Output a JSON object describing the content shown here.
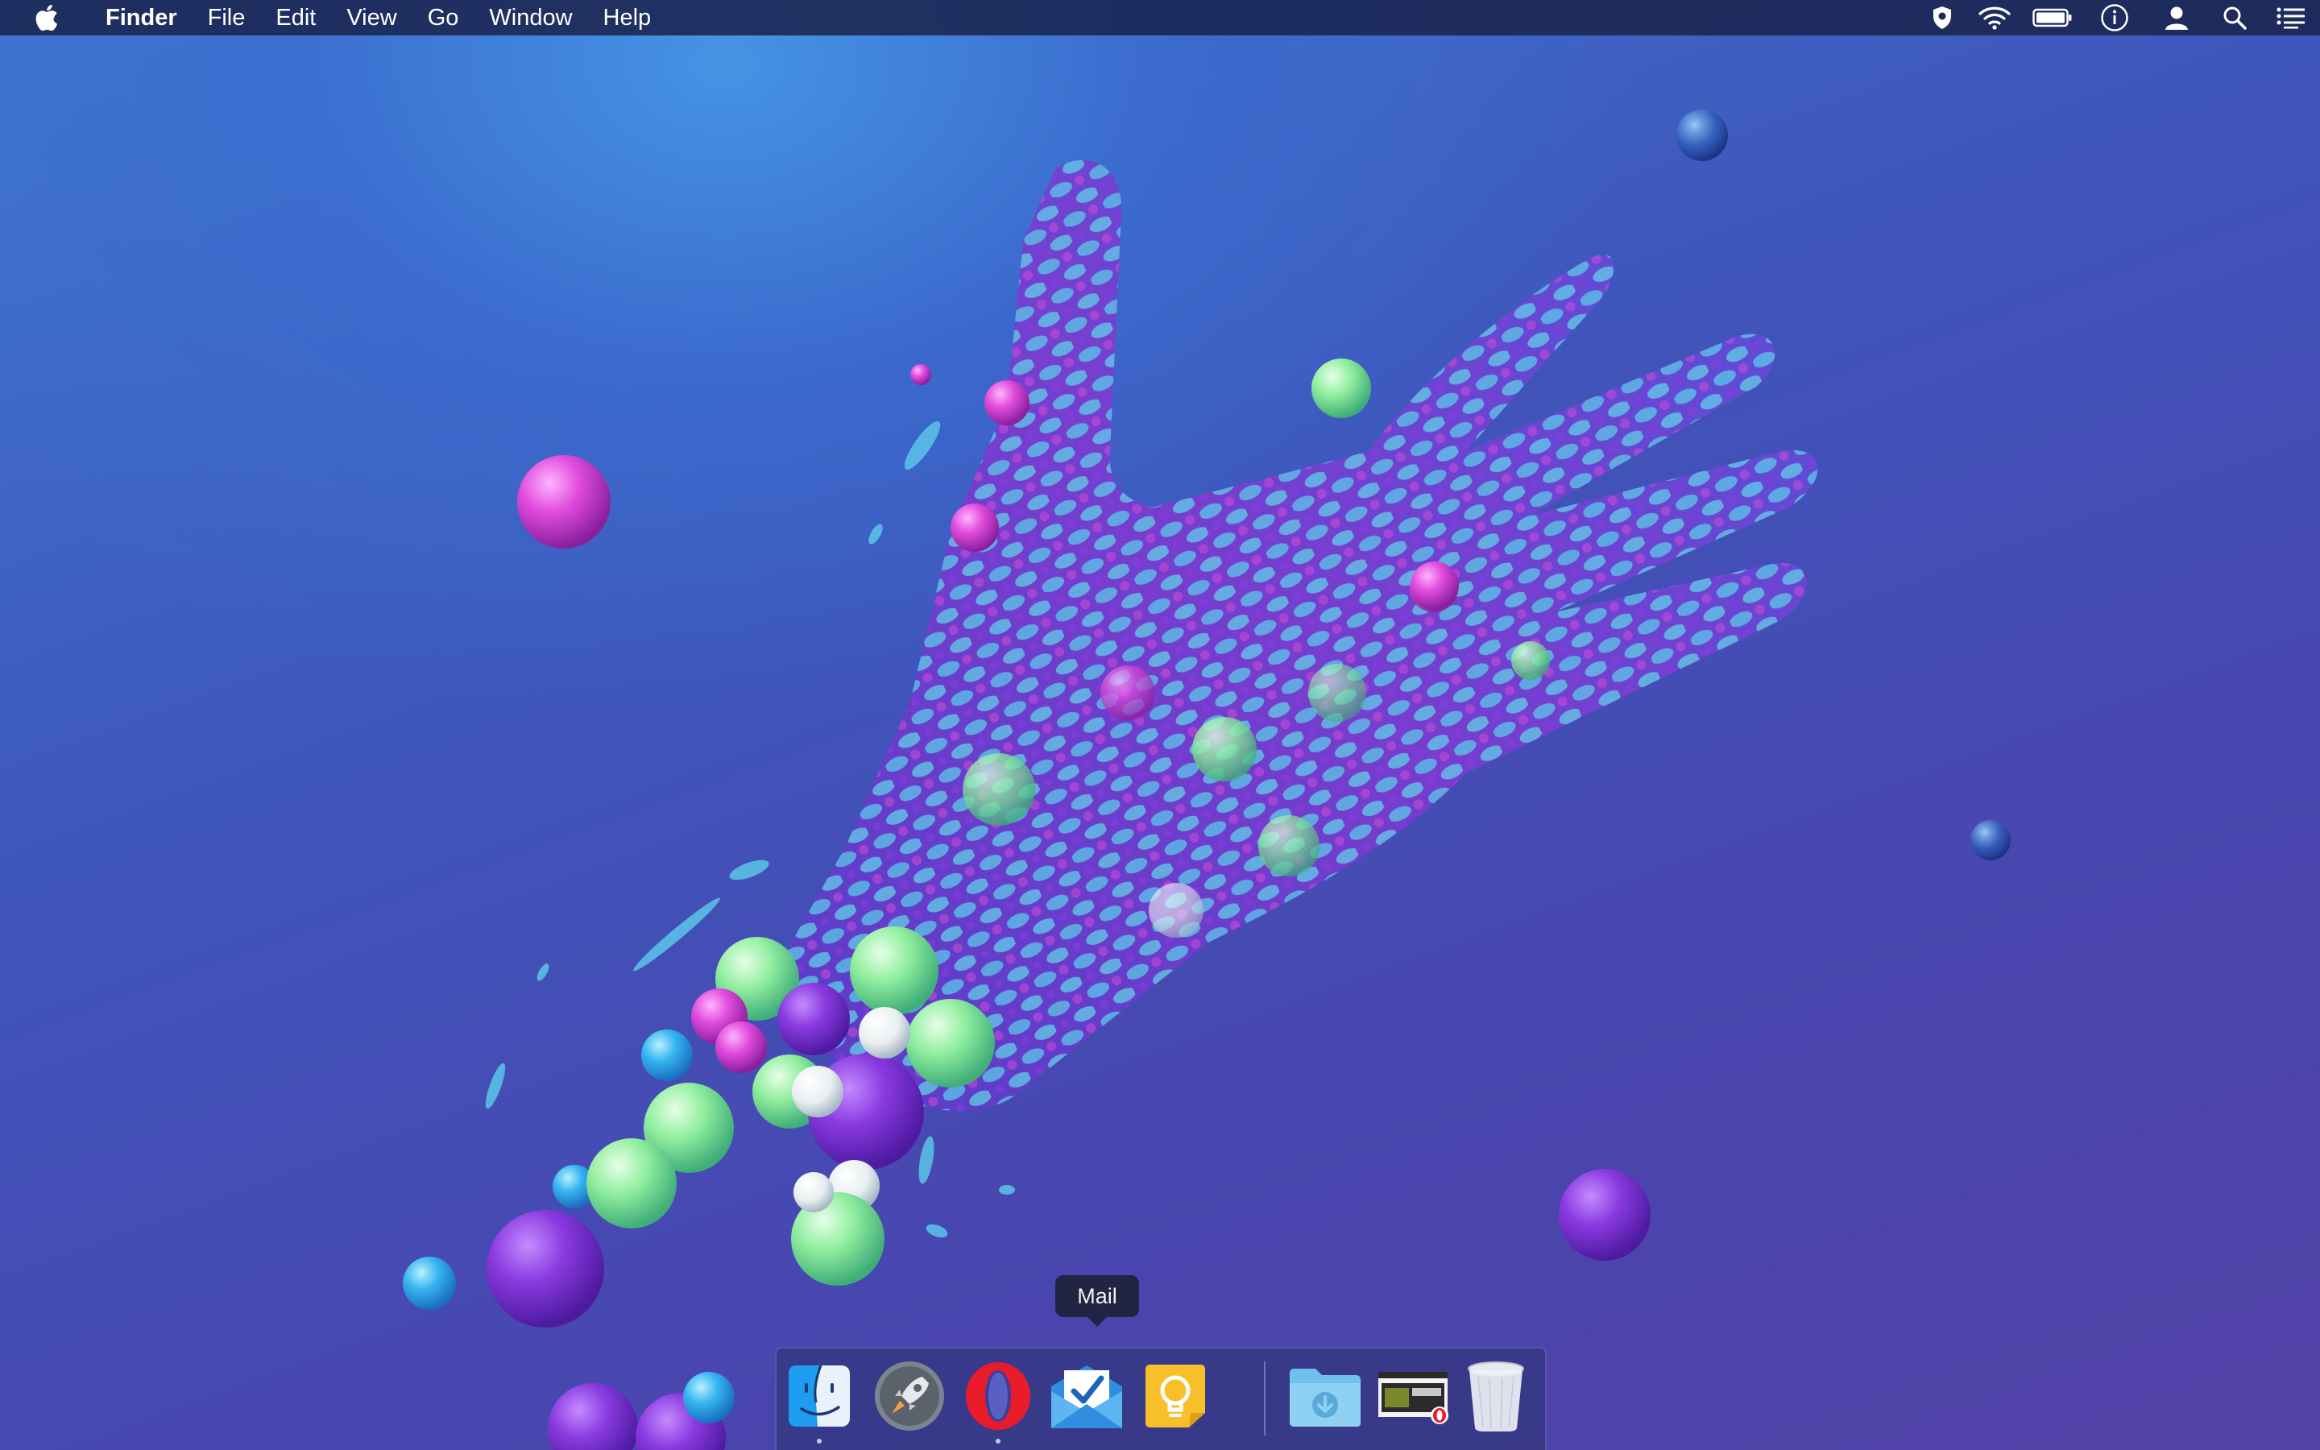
{
  "menubar": {
    "apple_icon": "apple-logo-icon",
    "app_name": "Finder",
    "menus": [
      "File",
      "Edit",
      "View",
      "Go",
      "Window",
      "Help"
    ],
    "status_icons": [
      "shield-icon",
      "wifi-icon",
      "battery-icon",
      "info-icon",
      "user-icon",
      "spotlight-search-icon",
      "notification-center-icon"
    ]
  },
  "dock": {
    "tooltip": "Mail",
    "apps": [
      {
        "icon": "finder-icon",
        "running": true
      },
      {
        "icon": "launchpad-rocket-icon",
        "running": false
      },
      {
        "icon": "opera-icon",
        "running": true
      },
      {
        "icon": "mail-icon",
        "running": false
      },
      {
        "icon": "idea-lightbulb-icon",
        "running": false
      }
    ],
    "others": [
      {
        "icon": "downloads-folder-icon"
      },
      {
        "icon": "browser-window-thumbnail-icon"
      },
      {
        "icon": "trash-icon"
      }
    ]
  },
  "colors": {
    "menubar_bg": "#1a2450",
    "wallpaper_top": "#3f78cf",
    "wallpaper_bottom": "#5242a6",
    "accent_green": "#8ef0a0",
    "accent_magenta": "#e050d8",
    "accent_purple": "#8a3ae0",
    "accent_cyan": "#37b6f0"
  }
}
